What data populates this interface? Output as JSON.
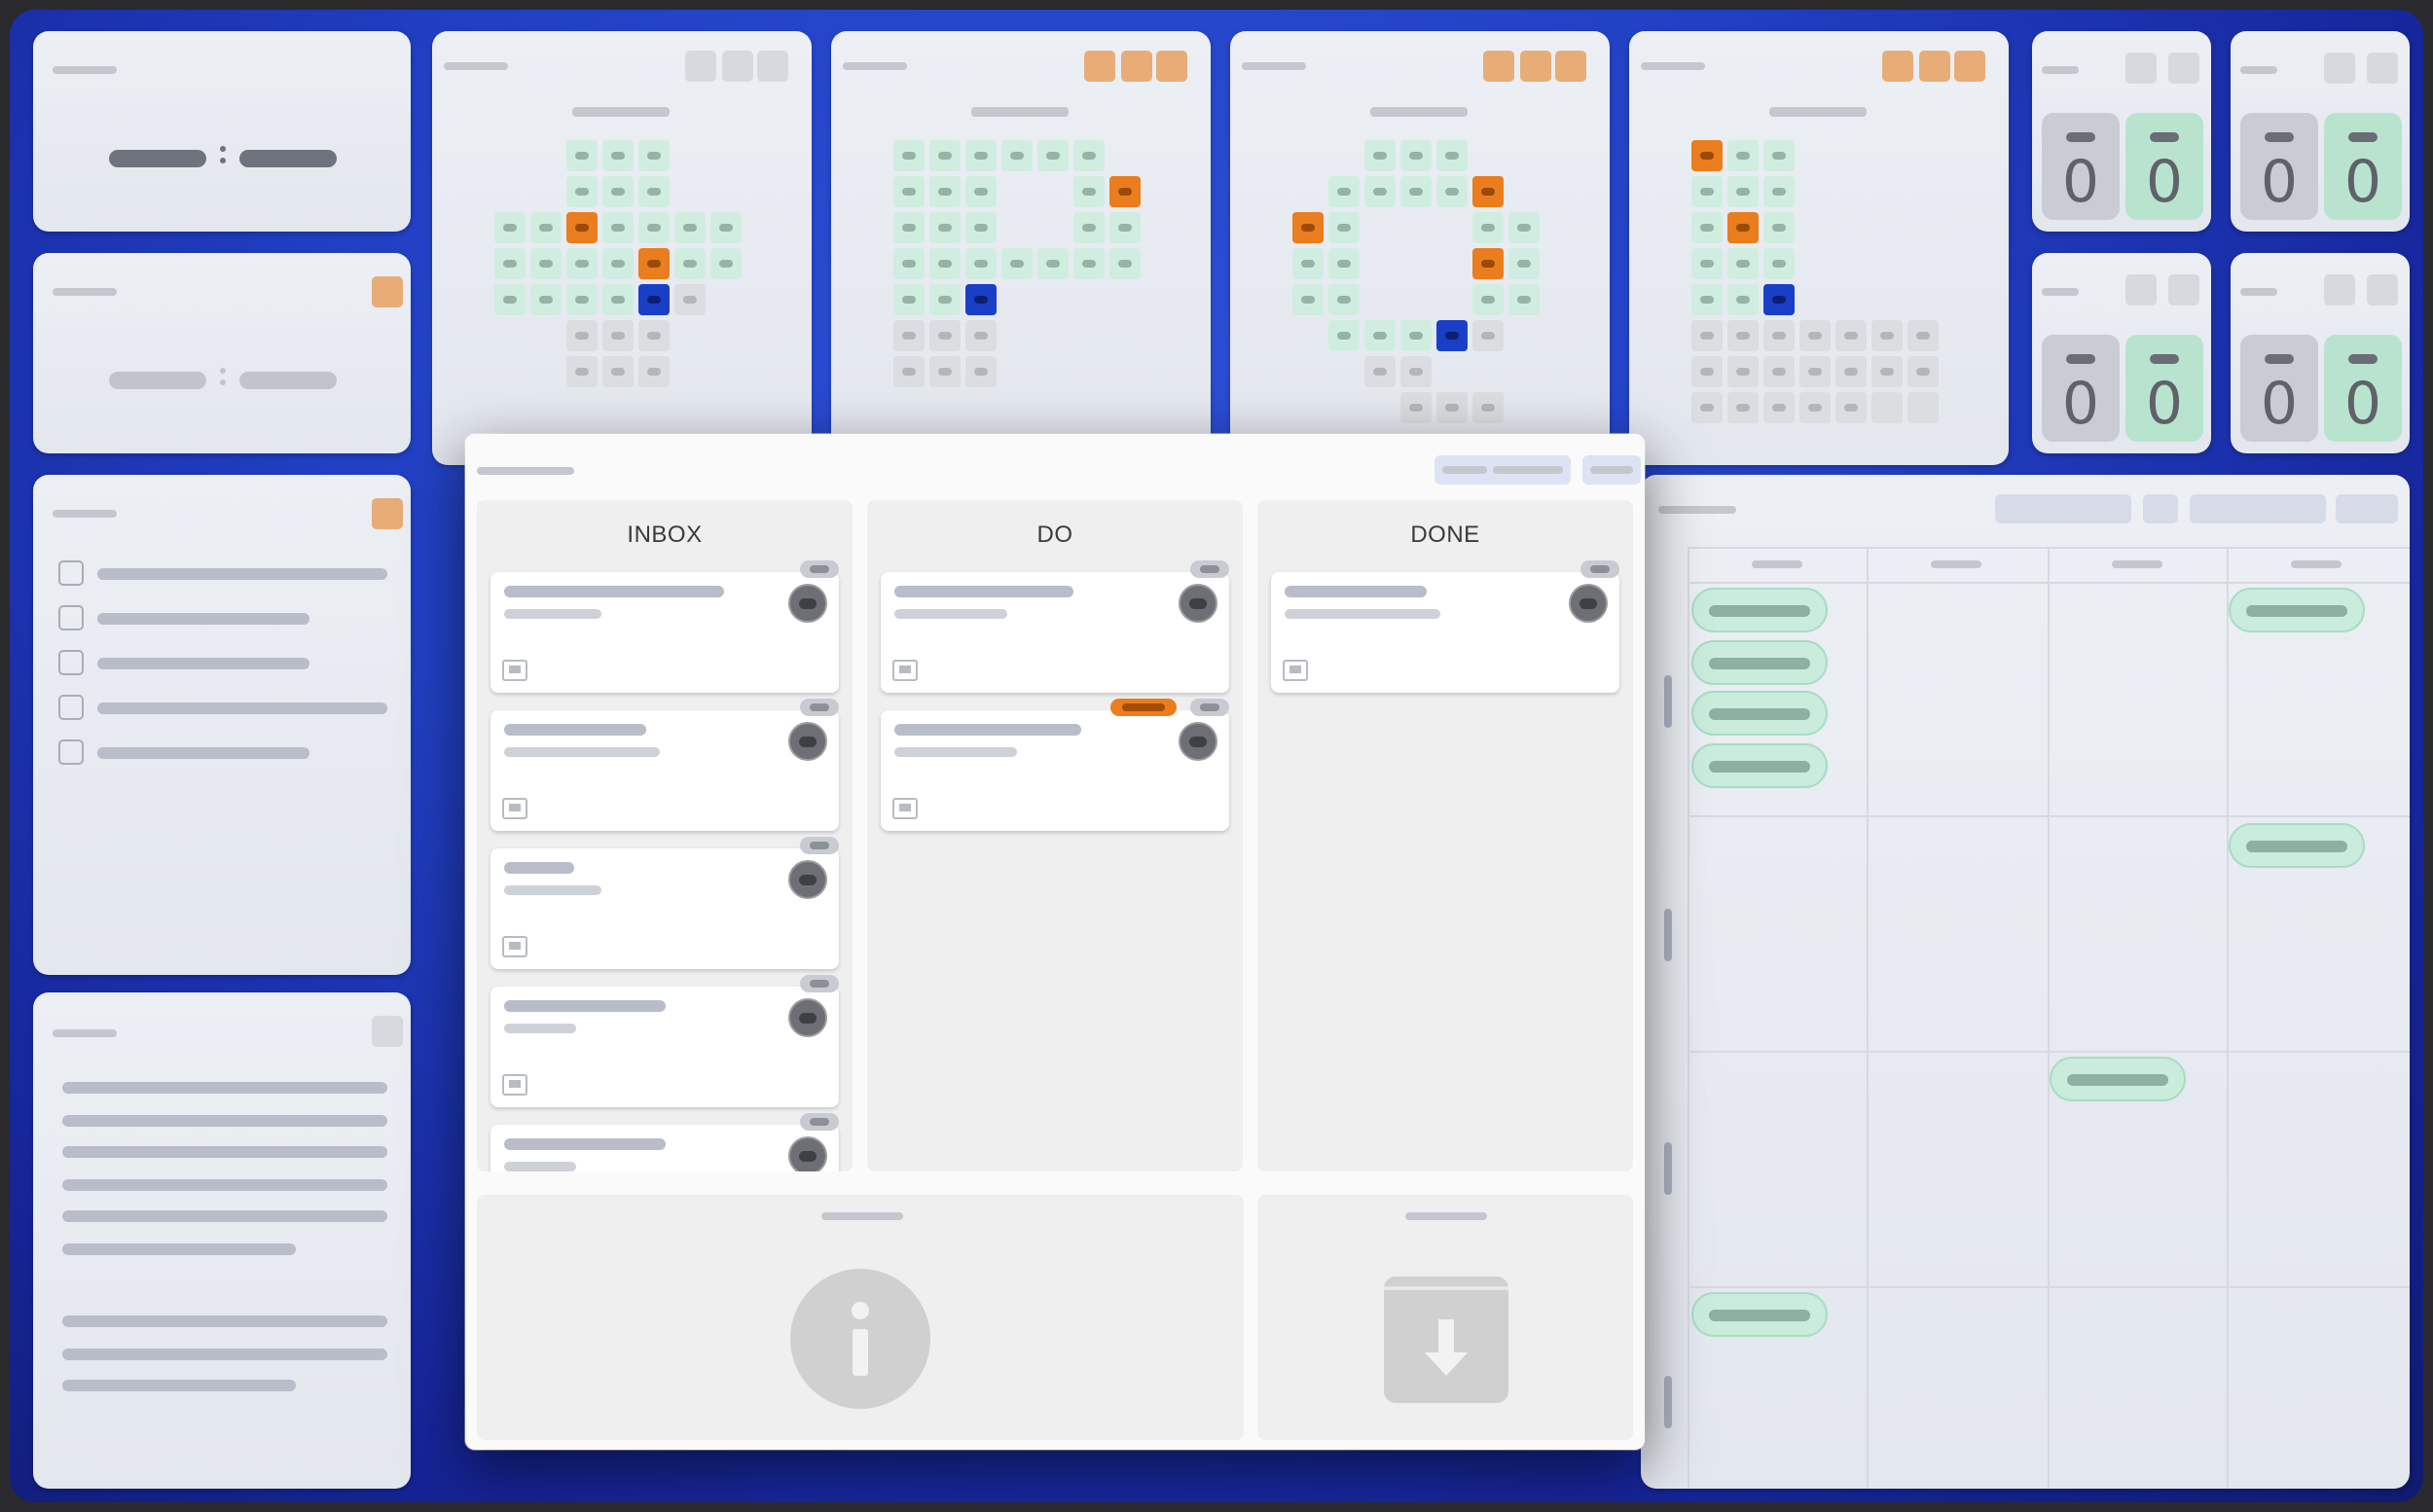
{
  "board": {
    "columns": [
      {
        "title": "INBOX"
      },
      {
        "title": "DO"
      },
      {
        "title": "DONE"
      }
    ]
  },
  "counters": [
    {
      "left": "0",
      "right": "0"
    },
    {
      "left": "0",
      "right": "0"
    },
    {
      "left": "0",
      "right": "0"
    },
    {
      "left": "0",
      "right": "0"
    }
  ],
  "colors": {
    "accent_orange": "#ea7d1d",
    "accent_blue": "#1a3fc7",
    "cell_green": "#cfeee0",
    "background_blue": "#2140c4"
  },
  "icons": {
    "info": "info-icon",
    "archive": "archive-download-icon",
    "comment": "comment-icon",
    "avatar": "user-avatar-icon"
  }
}
